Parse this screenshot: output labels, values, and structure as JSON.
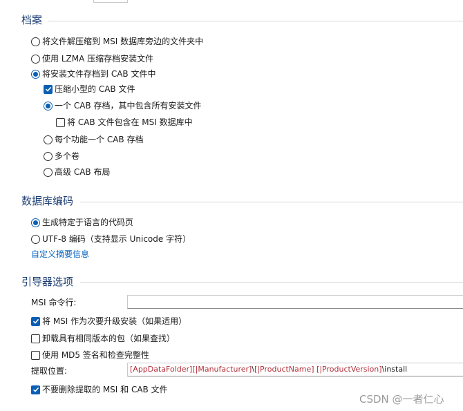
{
  "archive": {
    "title": "档案",
    "options": {
      "extract_next_to_msi": "将文件解压缩到 MSI 数据库旁边的文件夹中",
      "lzma": "使用 LZMA 压缩存档安装文件",
      "cab": "将安装文件存档到 CAB 文件中"
    },
    "cab_sub": {
      "compress_small": "压缩小型的 CAB 文件",
      "one_cab": "一个 CAB 存档，其中包含所有安装文件",
      "embed_in_msi": "将 CAB 文件包含在 MSI 数据库中",
      "per_feature": "每个功能一个 CAB 存档",
      "multi_volume": "多个卷",
      "advanced": "高级 CAB 布局"
    },
    "state": {
      "selected_mode": "cab",
      "compress_small": true,
      "cab_layout": "one_cab",
      "embed_in_msi": false
    }
  },
  "db_encoding": {
    "title": "数据库编码",
    "options": {
      "lang_codepage": "生成特定于语言的代码页",
      "utf8": "UTF-8 编码（支持显示 Unicode 字符）"
    },
    "selected": "lang_codepage",
    "summary_link": "自定义摘要信息"
  },
  "bootstrapper": {
    "title": "引导器选项",
    "msi_cmdline_label": "MSI 命令行:",
    "msi_cmdline_value": "",
    "minor_upgrade": "将 MSI 作为次要升级安装（如果适用）",
    "uninstall_same": "卸载具有相同版本的包（如果查找）",
    "md5_sign": "使用 MD5 签名和检查完整性",
    "extract_location_label": "提取位置:",
    "extract_location_parts": {
      "p1": "[AppDataFolder]",
      "p2": "[|Manufacturer]",
      "p3": "\\",
      "p4": "[|ProductName]",
      "p5": " ",
      "p6": "[|ProductVersion]",
      "p7": "\\install"
    },
    "keep_extracted": "不要删除提取的 MSI 和 CAB 文件",
    "state": {
      "minor_upgrade": true,
      "uninstall_same": false,
      "md5_sign": false,
      "keep_extracted": true
    }
  },
  "watermark": "CSDN @一者仁心",
  "colors": {
    "accent": "#0a5fb4",
    "section_title": "#1e3f73",
    "link": "#0a66c2",
    "token": "#b5303a"
  }
}
